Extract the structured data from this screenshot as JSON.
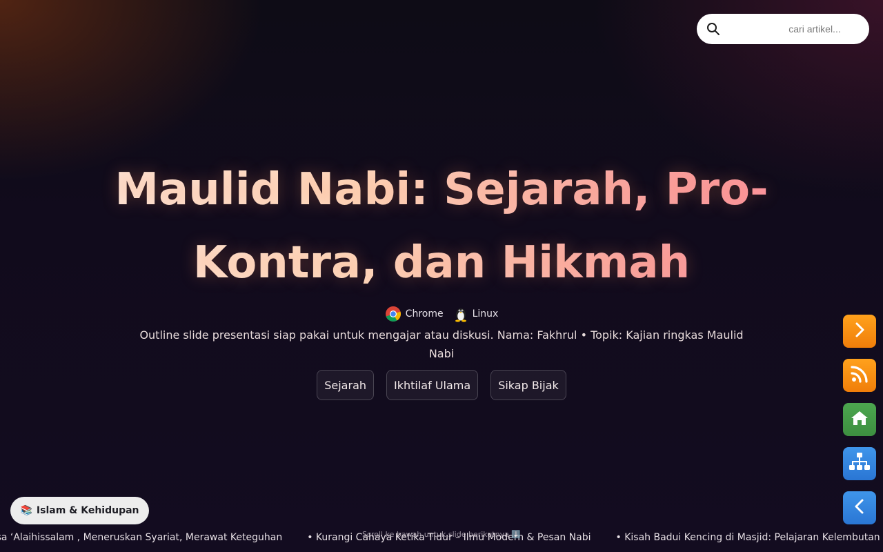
{
  "search": {
    "placeholder": "cari artikel..."
  },
  "hero": {
    "title": "Maulid Nabi: Sejarah, Pro-Kontra, dan Hikmah",
    "platforms": [
      {
        "label": "Chrome",
        "icon": "chrome-icon"
      },
      {
        "label": "Linux",
        "icon": "linux-tux-icon"
      }
    ],
    "subtitle": "Outline slide presentasi siap pakai untuk mengajar atau diskusi. Nama: Fakhrul • Topik: Kajian ringkas Maulid Nabi",
    "tags": [
      "Sejarah",
      "Ikhtilaf Ulama",
      "Sikap Bijak"
    ]
  },
  "side_nav": [
    {
      "name": "next-button",
      "icon": "chevron-right-icon",
      "color": "#f5900f"
    },
    {
      "name": "rss-button",
      "icon": "rss-icon",
      "color": "#f5900f"
    },
    {
      "name": "home-button",
      "icon": "home-icon",
      "color": "#45a048"
    },
    {
      "name": "sitemap-button",
      "icon": "sitemap-icon",
      "color": "#3386e0"
    },
    {
      "name": "back-button",
      "icon": "chevron-left-icon",
      "color": "#3386e0"
    }
  ],
  "category": {
    "emoji": "📚",
    "label": "Islam & Kehidupan"
  },
  "ticker": {
    "items": [
      "asa ‘Alaihissalam , Meneruskan Syariat, Merawat Keteguhan",
      "•  Kurangi Cahaya Ketika Tidur – Ilmu Modern & Pesan Nabi",
      "•  Kisah Badui Kencing di Masjid: Pelajaran Kelembutan & P"
    ],
    "scroll_hint": "Scroll ke bawah untuk slide berikutnya ⬇️"
  },
  "colors": {
    "accent_orange": "#f5900f",
    "accent_green": "#45a048",
    "accent_blue": "#3386e0",
    "background": "#110b1c"
  }
}
